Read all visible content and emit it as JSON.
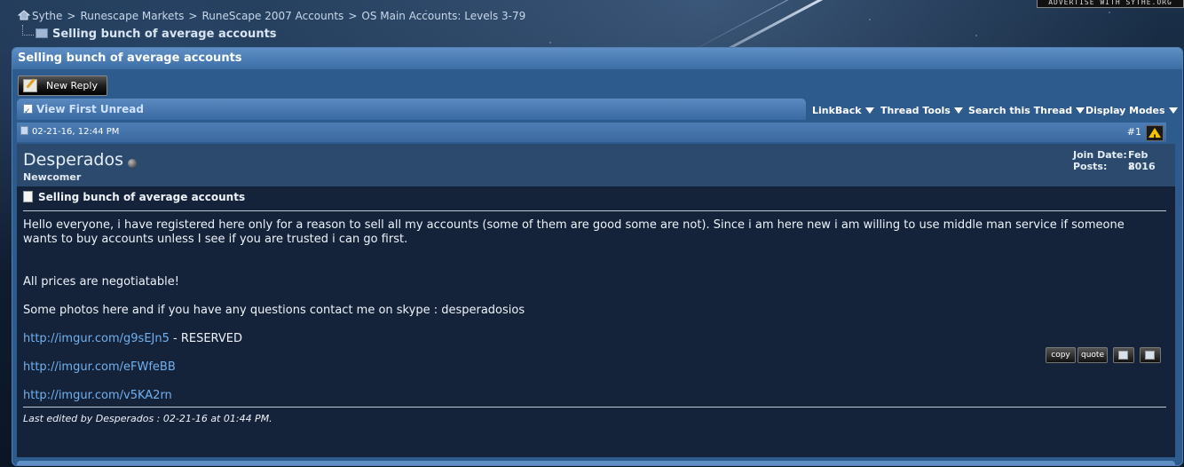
{
  "breadcrumb": {
    "items": [
      "Sythe",
      "Runescape Markets",
      "RuneScape 2007 Accounts",
      "OS Main Accounts: Levels 3-79"
    ],
    "separator": ">",
    "current": "Selling bunch of average accounts"
  },
  "advert": {
    "text": "ADVERTISE WITH SYTHE.ORG"
  },
  "thread": {
    "title": "Selling bunch of average accounts",
    "new_reply_label": "New Reply",
    "view_first_unread": "View First Unread",
    "tools": [
      "LinkBack",
      "Thread Tools",
      "Search this Thread",
      "Display Modes"
    ]
  },
  "post": {
    "date": "02-21-16, 12:44 PM",
    "number": "#1",
    "username": "Desperados",
    "rank": "Newcomer",
    "join_date_label": "Join Date:",
    "join_date": "Feb 2016",
    "posts_label": "Posts:",
    "posts": "8",
    "title": "Selling bunch of average accounts",
    "paragraph1": "Hello everyone, i have registered here only for a reason to sell all my accounts (some of them are good some are not). Since i am here new i am willing to use middle man service if someone wants to buy accounts unless I see if you are trusted i can go first.",
    "paragraph2": "All prices are negotiatable!",
    "paragraph3": "Some photos here and if you have any questions contact me on skype : desperadosios",
    "link1": "http://imgur.com/g9sEJn5",
    "link1_suffix": " - RESERVED",
    "link2": "http://imgur.com/eFWfeBB",
    "link3": "http://imgur.com/v5KA2rn",
    "edited": "Last edited by Desperados : 02-21-16 at 01:44 PM."
  },
  "actions": {
    "copy": "copy",
    "quote": "quote"
  },
  "colors": {
    "link": "#72b0ee",
    "panel": "#2e5b8d",
    "post_bg": "#14223a"
  }
}
